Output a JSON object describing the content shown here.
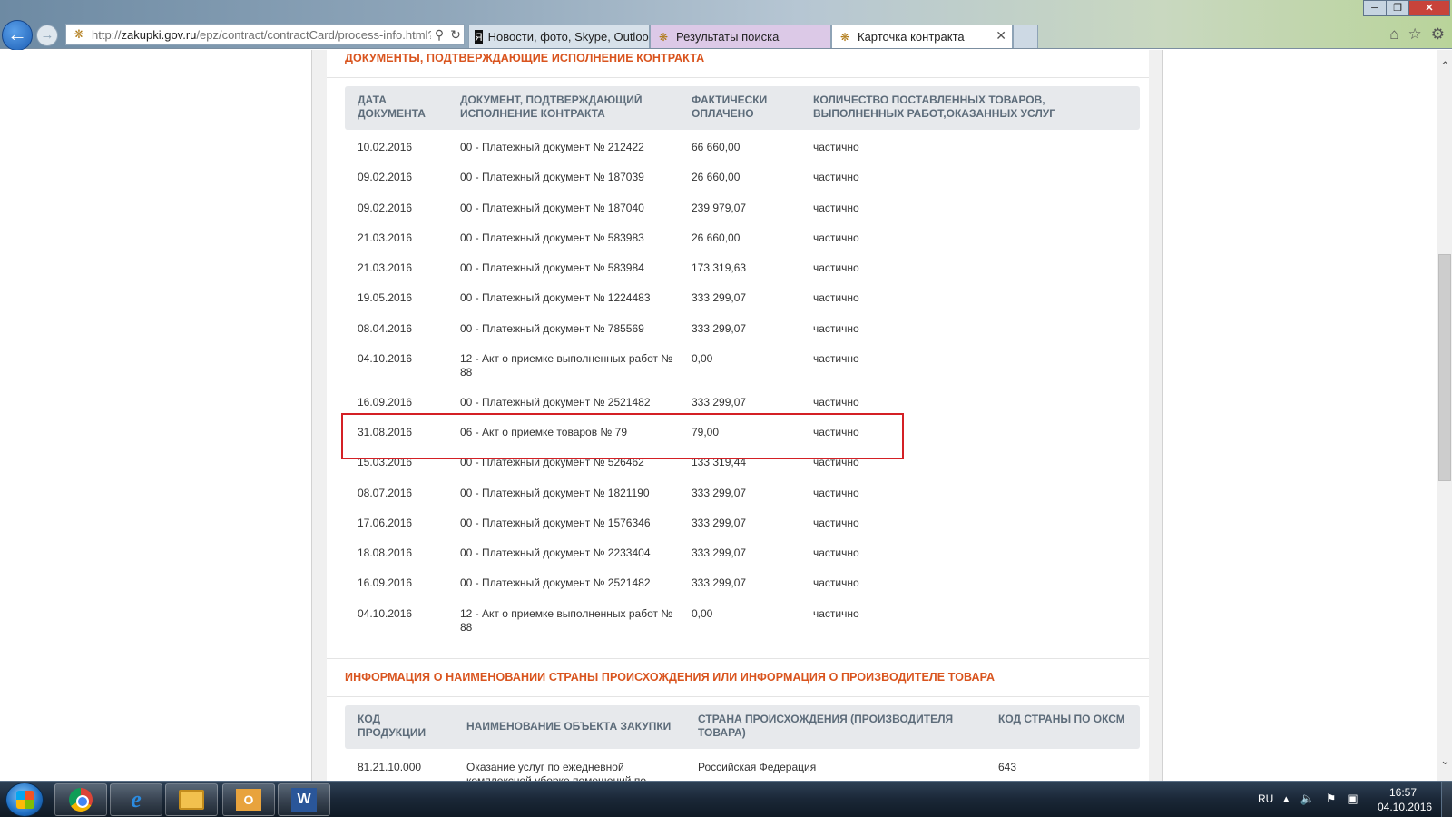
{
  "browser": {
    "url_prefix": "http://",
    "url_domain": "zakupki.gov.ru",
    "url_path": "/epz/contract/contractCard/process-info.html?",
    "tabs": [
      {
        "label": "Новости, фото, Skype, Outloo..."
      },
      {
        "label": "Результаты поиска"
      },
      {
        "label": "Карточка контракта"
      }
    ]
  },
  "section1": {
    "title": "ДОКУМЕНТЫ, ПОДТВЕРЖДАЮЩИЕ ИСПОЛНЕНИЕ КОНТРАКТА",
    "headers": {
      "date": "ДАТА ДОКУМЕНТА",
      "document": "ДОКУМЕНТ, ПОДТВЕРЖДАЮЩИЙ ИСПОЛНЕНИЕ КОНТРАКТА",
      "paid": "ФАКТИЧЕСКИ ОПЛАЧЕНО",
      "quantity": "КОЛИЧЕСТВО ПОСТАВЛЕННЫХ ТОВАРОВ, ВЫПОЛНЕННЫХ РАБОТ,ОКАЗАННЫХ УСЛУГ"
    },
    "rows": [
      {
        "date": "10.02.2016",
        "document": "00 - Платежный документ № 212422",
        "paid": "66 660,00",
        "status": "частично"
      },
      {
        "date": "09.02.2016",
        "document": "00 - Платежный документ № 187039",
        "paid": "26 660,00",
        "status": "частично"
      },
      {
        "date": "09.02.2016",
        "document": "00 - Платежный документ № 187040",
        "paid": "239 979,07",
        "status": "частично"
      },
      {
        "date": "21.03.2016",
        "document": "00 - Платежный документ № 583983",
        "paid": "26 660,00",
        "status": "частично"
      },
      {
        "date": "21.03.2016",
        "document": "00 - Платежный документ № 583984",
        "paid": "173 319,63",
        "status": "частично"
      },
      {
        "date": "19.05.2016",
        "document": "00 - Платежный документ № 1224483",
        "paid": "333 299,07",
        "status": "частично"
      },
      {
        "date": "08.04.2016",
        "document": "00 - Платежный документ № 785569",
        "paid": "333 299,07",
        "status": "частично"
      },
      {
        "date": "04.10.2016",
        "document": "12 - Акт о приемке выполненных работ № 88",
        "paid": "0,00",
        "status": "частично"
      },
      {
        "date": "16.09.2016",
        "document": "00 - Платежный документ № 2521482",
        "paid": "333 299,07",
        "status": "частично"
      },
      {
        "date": "31.08.2016",
        "document": "06 - Акт о приемке товаров № 79",
        "paid": "79,00",
        "status": "частично"
      },
      {
        "date": "15.03.2016",
        "document": "00 - Платежный документ № 526462",
        "paid": "133 319,44",
        "status": "частично"
      },
      {
        "date": "08.07.2016",
        "document": "00 - Платежный документ № 1821190",
        "paid": "333 299,07",
        "status": "частично"
      },
      {
        "date": "17.06.2016",
        "document": "00 - Платежный документ № 1576346",
        "paid": "333 299,07",
        "status": "частично"
      },
      {
        "date": "18.08.2016",
        "document": "00 - Платежный документ № 2233404",
        "paid": "333 299,07",
        "status": "частично"
      },
      {
        "date": "16.09.2016",
        "document": "00 - Платежный документ № 2521482",
        "paid": "333 299,07",
        "status": "частично"
      },
      {
        "date": "04.10.2016",
        "document": "12 - Акт о приемке выполненных работ № 88",
        "paid": "0,00",
        "status": "частично"
      }
    ]
  },
  "section2": {
    "title": "ИНФОРМАЦИЯ О НАИМЕНОВАНИИ СТРАНЫ ПРОИСХОЖДЕНИЯ ИЛИ ИНФОРМАЦИЯ О ПРОИЗВОДИТЕЛЕ ТОВАРА",
    "headers": {
      "code": "КОД ПРОДУКЦИИ",
      "name": "НАИМЕНОВАНИЕ ОБЪЕКТА ЗАКУПКИ",
      "country": "СТРАНА ПРОИСХОЖДЕНИЯ (ПРОИЗВОДИТЕЛЯ ТОВАРА)",
      "oksm": "КОД СТРАНЫ ПО ОКСМ"
    },
    "rows": [
      {
        "code": "81.21.10.000",
        "name": "Оказание услуг по ежедневной комплексной уборке помещений по",
        "country": "Российская Федерация",
        "oksm": "643"
      }
    ]
  },
  "taskbar": {
    "language": "RU",
    "time": "16:57",
    "date": "04.10.2016"
  },
  "colors": {
    "section_title": "#d9541e",
    "header_bg": "#e7e9ec",
    "highlight_border": "#d42025"
  }
}
